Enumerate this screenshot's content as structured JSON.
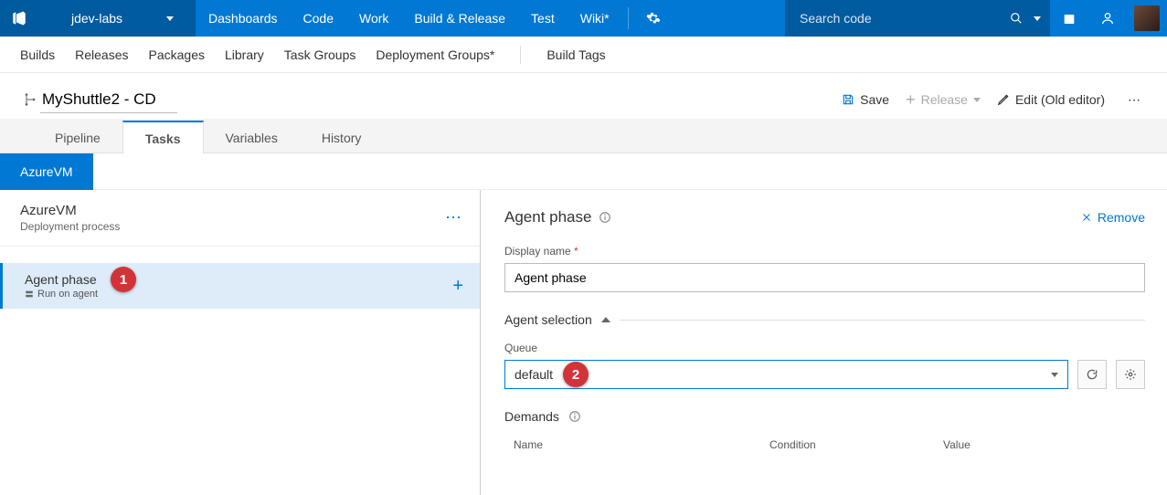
{
  "top": {
    "project": "jdev-labs",
    "nav": [
      "Dashboards",
      "Code",
      "Work",
      "Build & Release",
      "Test",
      "Wiki*"
    ],
    "nav_active_index": 3,
    "search_placeholder": "Search code"
  },
  "subnav": {
    "items": [
      "Builds",
      "Releases",
      "Packages",
      "Library",
      "Task Groups",
      "Deployment Groups*"
    ],
    "right": "Build Tags"
  },
  "title": {
    "value": "MyShuttle2 - CD",
    "actions": {
      "save": "Save",
      "release": "Release",
      "edit": "Edit (Old editor)"
    }
  },
  "tabs": {
    "items": [
      "Pipeline",
      "Tasks",
      "Variables",
      "History"
    ],
    "active_index": 1
  },
  "env_chip": "AzureVM",
  "left": {
    "env_name": "AzureVM",
    "env_sub": "Deployment process",
    "task_name": "Agent phase",
    "task_sub": "Run on agent"
  },
  "right": {
    "heading": "Agent phase",
    "remove": "Remove",
    "display_name_label": "Display name",
    "display_name_value": "Agent phase",
    "agent_selection": "Agent selection",
    "queue_label": "Queue",
    "queue_value": "default",
    "demands_label": "Demands",
    "table": {
      "c1": "Name",
      "c2": "Condition",
      "c3": "Value"
    }
  },
  "badges": {
    "1": "1",
    "2": "2"
  }
}
